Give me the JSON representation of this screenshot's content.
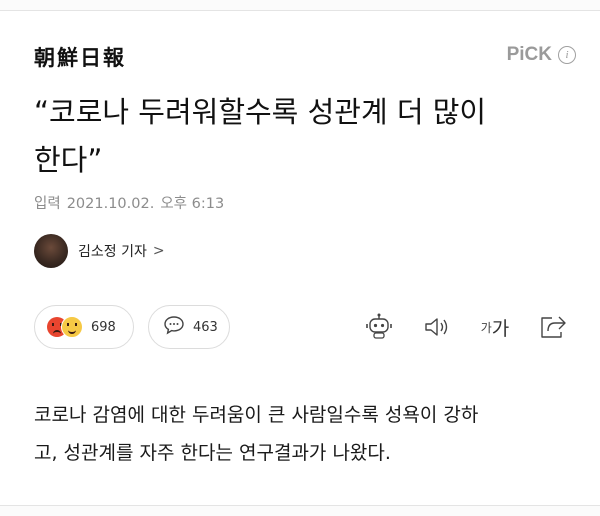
{
  "header": {
    "publisher_logo_text": "朝鮮日報",
    "pick_label": "PiCK",
    "pick_info_glyph": "i"
  },
  "article": {
    "headline_line1": "“코로나 두려워할수록 성관계 더 많이",
    "headline_line2": "한다”",
    "dateline": {
      "label": "입력",
      "date": "2021.10.02.",
      "time": "오후 6:13"
    },
    "author": {
      "name": "김소정 기자",
      "chevron": ">"
    },
    "reactions": {
      "count": "698",
      "emoji_icons": [
        "angry-face-icon",
        "smiling-face-icon"
      ]
    },
    "comments": {
      "count": "463",
      "icon": "speech-bubble-icon"
    },
    "toolbar": {
      "font_size_small": "가",
      "font_size_large": "가",
      "icons": [
        "robot-reader-icon",
        "speaker-icon",
        "font-size-icon",
        "share-icon"
      ]
    },
    "body_line1": "코로나 감염에 대한 두려움이 큰 사람일수록 성욕이 강하",
    "body_line2": "고, 성관계를 자주 한다는 연구결과가 나왔다."
  },
  "colors": {
    "text": "#111111",
    "meta_gray": "#8c8c8c",
    "pick_gray": "#9a9a9a",
    "pill_border": "#dcdcdc",
    "angry_red": "#e8452f",
    "smile_yellow": "#f6c945"
  }
}
